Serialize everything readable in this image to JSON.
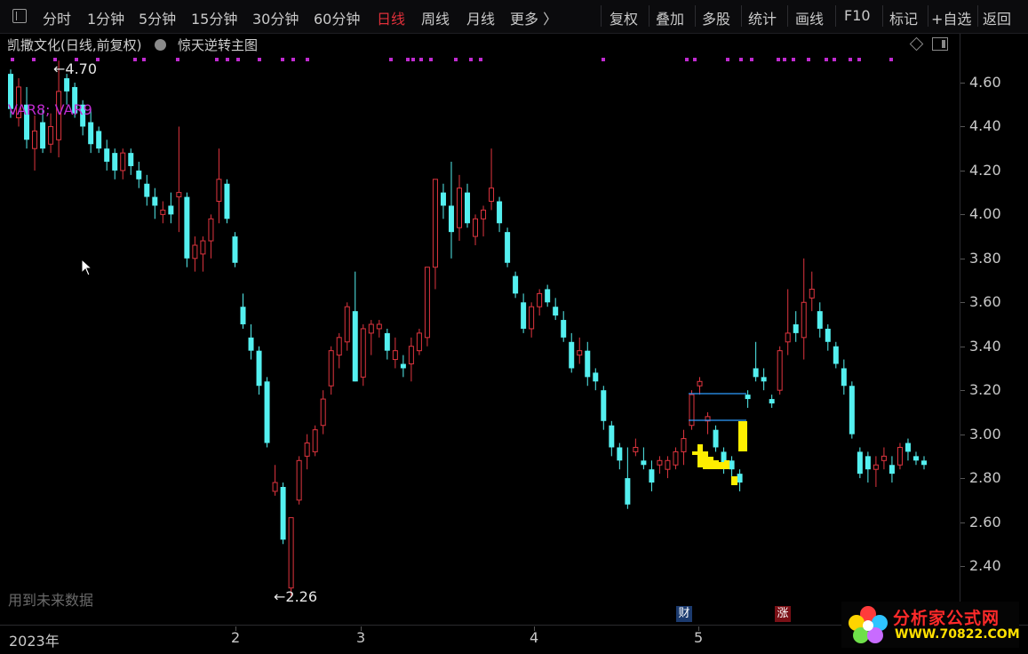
{
  "toolbar": {
    "toggle_icon": "panel-toggle-icon",
    "periods": [
      "分时",
      "1分钟",
      "5分钟",
      "15分钟",
      "30分钟",
      "60分钟",
      "日线",
      "周线",
      "月线",
      "更多 〉"
    ],
    "active_period": "日线",
    "actions": [
      "复权",
      "叠加",
      "多股",
      "统计",
      "画线",
      "F10",
      "标记",
      "+自选",
      "返回"
    ]
  },
  "header": {
    "stock_title": "凯撒文化(日线,前复权)",
    "indicator_name": "惊天逆转主图",
    "indicator_icon": "dropdown-circle-icon",
    "right_icons": [
      "diamond-icon",
      "panel-icon"
    ]
  },
  "overlay": {
    "var_label": "VAR8; VAR9",
    "future_label": "用到未来数据",
    "high_label": "4.70",
    "low_label": "2.26"
  },
  "y_axis": {
    "ticks": [
      "4.60",
      "4.40",
      "4.20",
      "4.00",
      "3.80",
      "3.60",
      "3.40",
      "3.20",
      "3.00",
      "2.80",
      "2.60",
      "2.40"
    ]
  },
  "x_axis": {
    "labels": [
      "2023年",
      "2",
      "3",
      "4",
      "5"
    ]
  },
  "markers": {
    "finance": "财",
    "limit_up": "涨"
  },
  "logo": {
    "title": "分析家公式网",
    "url": "WWW.70822.COM"
  },
  "colors": {
    "up": "#e0353f",
    "down": "#54f0f0",
    "signal": "#c02bd0",
    "highlight": "#ffee00",
    "line": "#2e9cff"
  },
  "chart_data": {
    "type": "candlestick",
    "ylim": [
      2.3,
      4.7
    ],
    "ohlc": [
      [
        4.64,
        4.66,
        4.44,
        4.48
      ],
      [
        4.44,
        4.62,
        4.4,
        4.58
      ],
      [
        4.5,
        4.58,
        4.3,
        4.34
      ],
      [
        4.3,
        4.45,
        4.2,
        4.38
      ],
      [
        4.42,
        4.48,
        4.28,
        4.3
      ],
      [
        4.32,
        4.46,
        4.28,
        4.4
      ],
      [
        4.34,
        4.7,
        4.26,
        4.56
      ],
      [
        4.62,
        4.64,
        4.5,
        4.56
      ],
      [
        4.58,
        4.6,
        4.44,
        4.46
      ],
      [
        4.5,
        4.52,
        4.36,
        4.4
      ],
      [
        4.42,
        4.48,
        4.28,
        4.32
      ],
      [
        4.38,
        4.4,
        4.28,
        4.3
      ],
      [
        4.3,
        4.34,
        4.2,
        4.24
      ],
      [
        4.28,
        4.3,
        4.16,
        4.2
      ],
      [
        4.2,
        4.3,
        4.16,
        4.28
      ],
      [
        4.28,
        4.3,
        4.18,
        4.22
      ],
      [
        4.2,
        4.24,
        4.12,
        4.16
      ],
      [
        4.14,
        4.18,
        4.04,
        4.08
      ],
      [
        4.08,
        4.12,
        3.98,
        4.04
      ],
      [
        4.0,
        4.06,
        3.96,
        4.02
      ],
      [
        4.04,
        4.1,
        3.96,
        4.0
      ],
      [
        4.08,
        4.4,
        3.92,
        4.1
      ],
      [
        4.08,
        4.1,
        3.76,
        3.8
      ],
      [
        3.8,
        3.9,
        3.74,
        3.86
      ],
      [
        3.82,
        3.9,
        3.74,
        3.88
      ],
      [
        3.88,
        4.0,
        3.8,
        3.98
      ],
      [
        4.06,
        4.3,
        3.96,
        4.16
      ],
      [
        4.14,
        4.16,
        3.96,
        3.98
      ],
      [
        3.9,
        3.92,
        3.76,
        3.78
      ],
      [
        3.58,
        3.64,
        3.48,
        3.5
      ],
      [
        3.44,
        3.5,
        3.34,
        3.38
      ],
      [
        3.38,
        3.4,
        3.18,
        3.22
      ],
      [
        3.24,
        3.26,
        2.94,
        2.96
      ],
      [
        2.74,
        2.86,
        2.72,
        2.78
      ],
      [
        2.76,
        2.78,
        2.5,
        2.52
      ],
      [
        2.3,
        2.62,
        2.26,
        2.62
      ],
      [
        2.7,
        2.9,
        2.68,
        2.88
      ],
      [
        2.9,
        3.0,
        2.84,
        2.96
      ],
      [
        2.92,
        3.04,
        2.9,
        3.02
      ],
      [
        3.04,
        3.2,
        3.0,
        3.16
      ],
      [
        3.22,
        3.4,
        3.18,
        3.38
      ],
      [
        3.36,
        3.46,
        3.3,
        3.44
      ],
      [
        3.42,
        3.6,
        3.38,
        3.58
      ],
      [
        3.56,
        3.74,
        3.24,
        3.24
      ],
      [
        3.26,
        3.5,
        3.22,
        3.48
      ],
      [
        3.46,
        3.52,
        3.36,
        3.5
      ],
      [
        3.48,
        3.52,
        3.44,
        3.5
      ],
      [
        3.46,
        3.48,
        3.34,
        3.38
      ],
      [
        3.34,
        3.44,
        3.3,
        3.38
      ],
      [
        3.32,
        3.36,
        3.26,
        3.3
      ],
      [
        3.32,
        3.44,
        3.24,
        3.4
      ],
      [
        3.38,
        3.48,
        3.36,
        3.46
      ],
      [
        3.44,
        3.76,
        3.4,
        3.76
      ],
      [
        3.76,
        4.16,
        3.66,
        4.16
      ],
      [
        4.1,
        4.14,
        3.98,
        4.04
      ],
      [
        4.04,
        4.24,
        3.8,
        3.92
      ],
      [
        3.94,
        4.18,
        3.88,
        4.12
      ],
      [
        4.1,
        4.14,
        3.94,
        3.96
      ],
      [
        3.9,
        4.0,
        3.86,
        3.98
      ],
      [
        3.98,
        4.04,
        3.9,
        4.02
      ],
      [
        4.06,
        4.3,
        4.02,
        4.12
      ],
      [
        4.06,
        4.08,
        3.92,
        3.96
      ],
      [
        3.92,
        3.94,
        3.76,
        3.78
      ],
      [
        3.72,
        3.74,
        3.62,
        3.64
      ],
      [
        3.6,
        3.64,
        3.46,
        3.48
      ],
      [
        3.48,
        3.6,
        3.44,
        3.58
      ],
      [
        3.58,
        3.66,
        3.54,
        3.64
      ],
      [
        3.66,
        3.68,
        3.58,
        3.6
      ],
      [
        3.58,
        3.62,
        3.52,
        3.54
      ],
      [
        3.52,
        3.56,
        3.42,
        3.44
      ],
      [
        3.42,
        3.46,
        3.28,
        3.3
      ],
      [
        3.36,
        3.44,
        3.32,
        3.38
      ],
      [
        3.38,
        3.42,
        3.22,
        3.26
      ],
      [
        3.28,
        3.3,
        3.2,
        3.24
      ],
      [
        3.2,
        3.22,
        3.02,
        3.06
      ],
      [
        3.04,
        3.06,
        2.9,
        2.94
      ],
      [
        2.94,
        2.96,
        2.84,
        2.88
      ],
      [
        2.8,
        2.94,
        2.66,
        2.68
      ],
      [
        2.92,
        2.98,
        2.9,
        2.94
      ],
      [
        2.88,
        2.94,
        2.84,
        2.86
      ],
      [
        2.84,
        2.88,
        2.74,
        2.78
      ],
      [
        2.86,
        2.9,
        2.82,
        2.88
      ],
      [
        2.84,
        2.9,
        2.8,
        2.88
      ],
      [
        2.86,
        2.94,
        2.84,
        2.92
      ],
      [
        2.92,
        3.02,
        2.86,
        2.98
      ],
      [
        3.04,
        3.2,
        3.02,
        3.18
      ],
      [
        3.22,
        3.26,
        3.18,
        3.24
      ],
      [
        3.06,
        3.1,
        3.0,
        3.08
      ],
      [
        3.02,
        3.04,
        2.92,
        2.94
      ],
      [
        2.92,
        2.94,
        2.82,
        2.86
      ],
      [
        2.88,
        2.9,
        2.8,
        2.84
      ],
      [
        2.82,
        2.84,
        2.74,
        2.78
      ],
      [
        3.18,
        3.2,
        3.12,
        3.16
      ],
      [
        3.3,
        3.42,
        3.24,
        3.26
      ],
      [
        3.26,
        3.3,
        3.2,
        3.24
      ],
      [
        3.16,
        3.18,
        3.12,
        3.14
      ],
      [
        3.2,
        3.4,
        3.18,
        3.38
      ],
      [
        3.42,
        3.66,
        3.36,
        3.46
      ],
      [
        3.5,
        3.56,
        3.42,
        3.46
      ],
      [
        3.44,
        3.8,
        3.34,
        3.6
      ],
      [
        3.62,
        3.74,
        3.56,
        3.66
      ],
      [
        3.56,
        3.6,
        3.44,
        3.48
      ],
      [
        3.48,
        3.5,
        3.38,
        3.42
      ],
      [
        3.4,
        3.42,
        3.3,
        3.32
      ],
      [
        3.3,
        3.34,
        3.18,
        3.22
      ],
      [
        3.22,
        3.24,
        2.98,
        3.0
      ],
      [
        2.92,
        2.94,
        2.8,
        2.82
      ],
      [
        2.9,
        2.92,
        2.78,
        2.84
      ],
      [
        2.84,
        2.9,
        2.76,
        2.86
      ],
      [
        2.88,
        2.94,
        2.84,
        2.9
      ],
      [
        2.86,
        2.9,
        2.78,
        2.82
      ],
      [
        2.86,
        2.96,
        2.84,
        2.94
      ],
      [
        2.96,
        2.98,
        2.88,
        2.92
      ],
      [
        2.9,
        2.92,
        2.86,
        2.88
      ],
      [
        2.88,
        2.9,
        2.84,
        2.86
      ]
    ]
  }
}
